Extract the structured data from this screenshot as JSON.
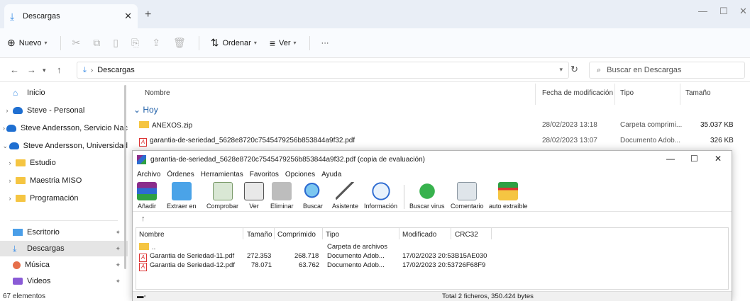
{
  "window": {
    "tab_title": "Descargas",
    "tab_close": "✕",
    "new_tab": "+",
    "minimize": "—",
    "maximize": "☐",
    "close": "✕"
  },
  "toolbar": {
    "new_label": "Nuevo",
    "sort_label": "Ordenar",
    "view_label": "Ver",
    "more": "···"
  },
  "address": {
    "path": "Descargas",
    "search_placeholder": "Buscar en Descargas"
  },
  "nav": {
    "items": [
      {
        "label": "Inicio",
        "icon": "home-icon"
      },
      {
        "label": "Steve - Personal",
        "icon": "cloud-icon"
      },
      {
        "label": "Steve Andersson, Servicio Nac",
        "icon": "cloud-icon"
      },
      {
        "label": "Steve Andersson, Universidad",
        "icon": "cloud-icon"
      },
      {
        "label": "Estudio",
        "icon": "folder-icon"
      },
      {
        "label": "Maestria MISO",
        "icon": "folder-icon"
      },
      {
        "label": "Programación",
        "icon": "folder-icon"
      },
      {
        "label": "Escritorio",
        "icon": "desktop-icon"
      },
      {
        "label": "Descargas",
        "icon": "download-icon"
      },
      {
        "label": "Música",
        "icon": "music-icon"
      },
      {
        "label": "Videos",
        "icon": "video-icon"
      }
    ]
  },
  "status": {
    "count": "67 elementos"
  },
  "files": {
    "columns": {
      "name": "Nombre",
      "date": "Fecha de modificación",
      "type": "Tipo",
      "size": "Tamaño"
    },
    "group": "Hoy",
    "rows": [
      {
        "name": "ANEXOS.zip",
        "date": "28/02/2023 13:18",
        "type": "Carpeta comprimi...",
        "size": "35.037 KB"
      },
      {
        "name": "garantia-de-seriedad_5628e8720c7545479256b853844a9f32.pdf",
        "date": "28/02/2023 13:07",
        "type": "Documento Adob...",
        "size": "326 KB"
      }
    ]
  },
  "winrar": {
    "title": "garantia-de-seriedad_5628e8720c7545479256b853844a9f32.pdf (copia de evaluación)",
    "menu": [
      "Archivo",
      "Órdenes",
      "Herramientas",
      "Favoritos",
      "Opciones",
      "Ayuda"
    ],
    "tools": [
      "Añadir",
      "Extraer en",
      "Comprobar",
      "Ver",
      "Eliminar",
      "Buscar",
      "Asistente",
      "Información",
      "Buscar virus",
      "Comentario",
      "auto extraíble"
    ],
    "columns": [
      "Nombre",
      "Tamaño",
      "Comprimido",
      "Tipo",
      "Modificado",
      "CRC32"
    ],
    "parent_row": {
      "name": "..",
      "type": "Carpeta de archivos"
    },
    "rows": [
      {
        "name": "Garantia de Seriedad-11.pdf",
        "size": "272.353",
        "packed": "268.718",
        "type": "Documento Adob...",
        "modified": "17/02/2023 20:53",
        "crc": "B15AE030"
      },
      {
        "name": "Garantia de Seriedad-12.pdf",
        "size": "78.071",
        "packed": "63.762",
        "type": "Documento Adob...",
        "modified": "17/02/2023 20:53",
        "crc": "726F68F9"
      }
    ],
    "status_total": "Total 2 ficheros, 350.424 bytes"
  }
}
